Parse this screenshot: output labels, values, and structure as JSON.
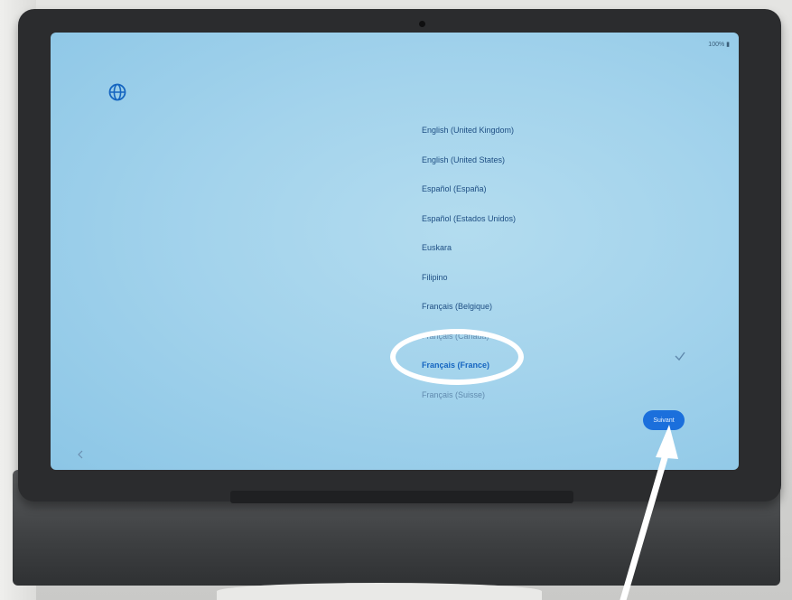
{
  "status_bar": {
    "battery": "100% ▮"
  },
  "languages": [
    {
      "label": "English (United Kingdom)"
    },
    {
      "label": "English (United States)"
    },
    {
      "label": "Español (España)"
    },
    {
      "label": "Español (Estados Unidos)"
    },
    {
      "label": "Euskara"
    },
    {
      "label": "Filipino"
    },
    {
      "label": "Français (Belgique)"
    },
    {
      "label": "Français (Canada)"
    },
    {
      "label": "Français (France)"
    },
    {
      "label": "Français (Suisse)"
    }
  ],
  "selected_language": "Français (France)",
  "next_button": {
    "label": "Suivant"
  },
  "icons": {
    "language": "globe-icon",
    "selected": "checkmark-icon",
    "back": "back-arrow-icon"
  },
  "colors": {
    "accent": "#1b6fdc",
    "screen_bg": "#a3d3ec",
    "annotation": "#ffffff"
  }
}
